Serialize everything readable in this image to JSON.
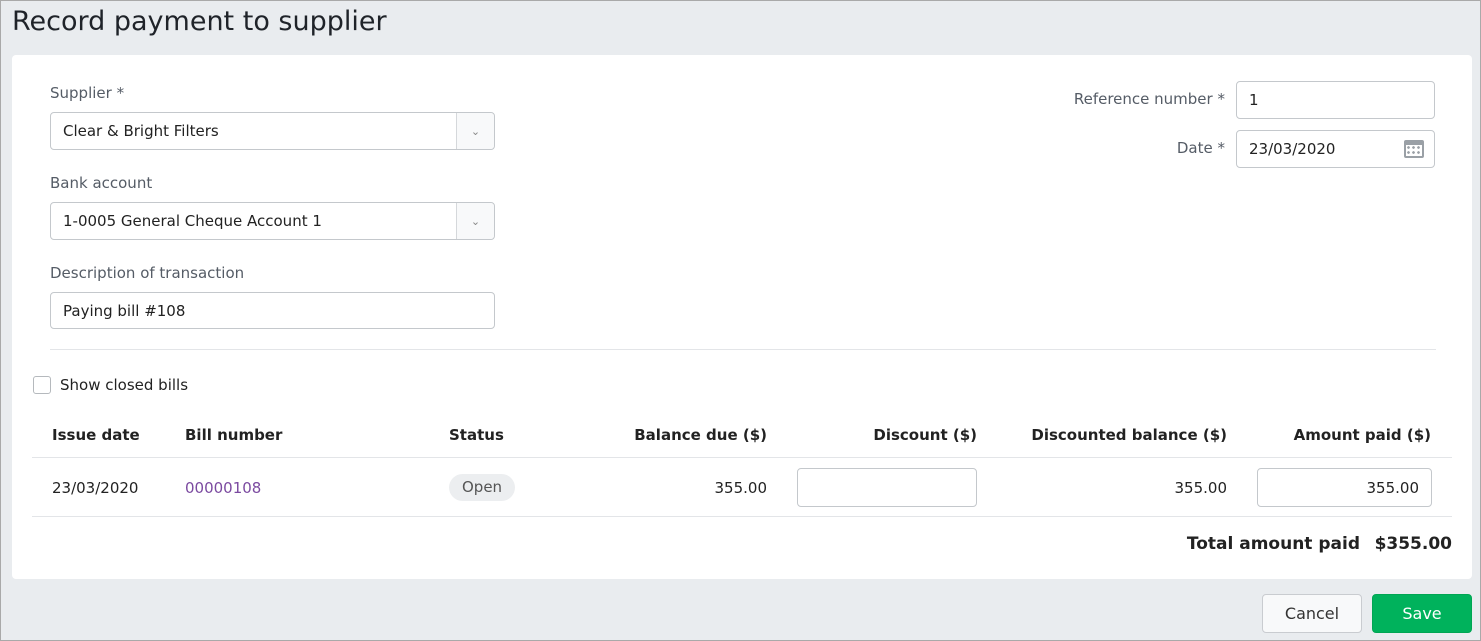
{
  "title": "Record payment to supplier",
  "form": {
    "supplier_label": "Supplier",
    "supplier_value": "Clear & Bright Filters",
    "bank_label": "Bank account",
    "bank_value": "1-0005 General Cheque Account 1",
    "description_label": "Description of transaction",
    "description_value": "Paying bill #108",
    "reference_label": "Reference number",
    "reference_value": "1",
    "date_label": "Date",
    "date_value": "23/03/2020",
    "required_mark": "*",
    "show_closed_label": "Show closed bills"
  },
  "table": {
    "headers": [
      "Issue date",
      "Bill number",
      "Status",
      "Balance due ($)",
      "Discount ($)",
      "Discounted balance ($)",
      "Amount paid ($)"
    ],
    "rows": [
      {
        "issue_date": "23/03/2020",
        "bill_number": "00000108",
        "status": "Open",
        "balance_due": "355.00",
        "discount": "",
        "discounted_balance": "355.00",
        "amount_paid": "355.00"
      }
    ]
  },
  "total": {
    "label": "Total amount paid",
    "value": "$355.00"
  },
  "buttons": {
    "cancel": "Cancel",
    "save": "Save"
  },
  "colors": {
    "save": "#00b25c",
    "link": "#7b4aa0"
  }
}
